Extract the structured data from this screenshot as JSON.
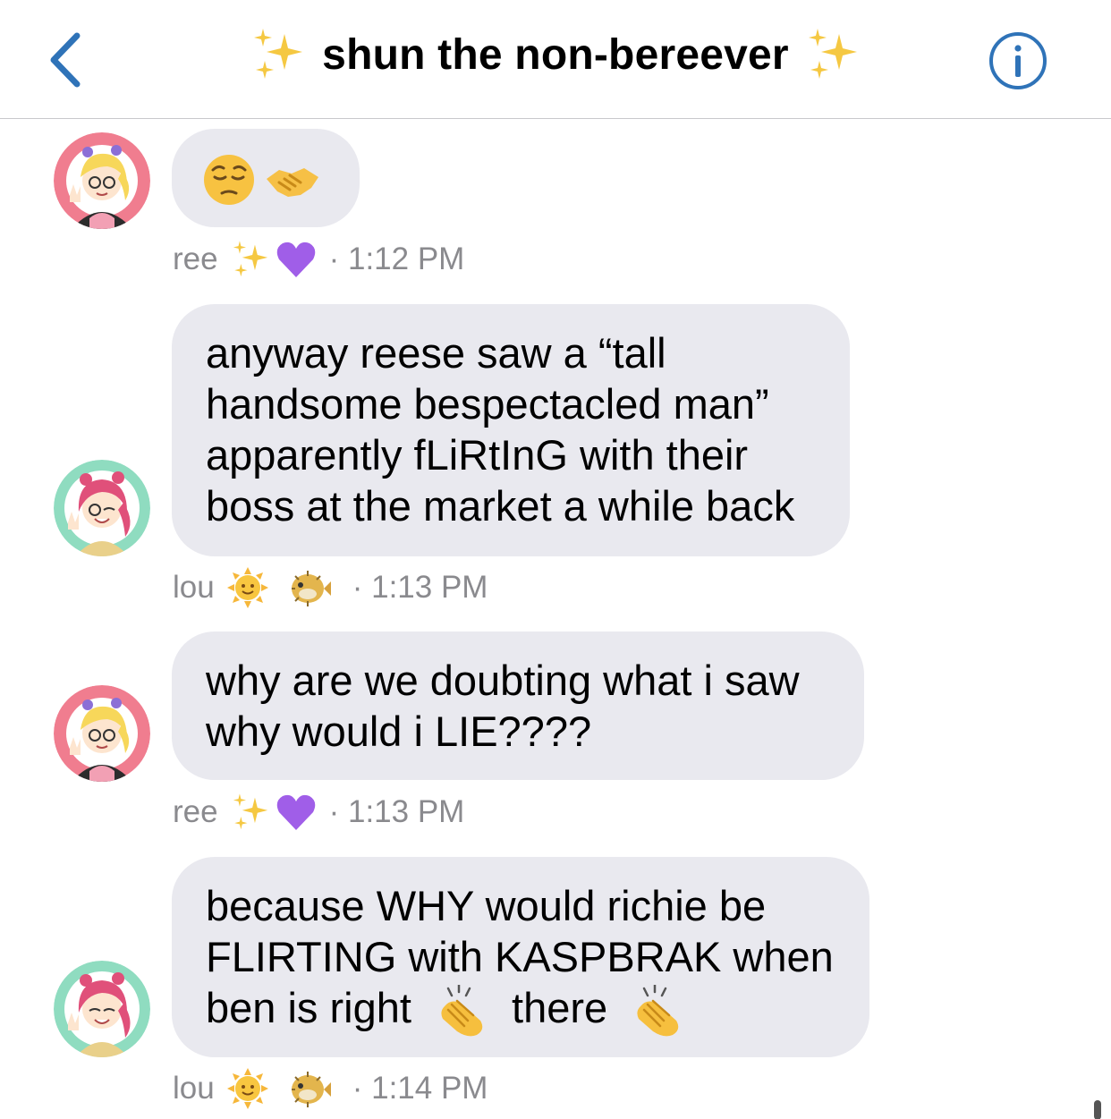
{
  "header": {
    "title": "shun the non-bereever",
    "back_icon": "chevron-left-icon",
    "info_icon": "info-icon",
    "accent_color": "#2f73b8"
  },
  "messages": [
    {
      "sender": "ree",
      "avatar": "avatar-ree",
      "content_emoji": [
        "pensive-face-emoji",
        "handshake-emoji"
      ],
      "timestamp": "· 1:12 PM"
    },
    {
      "sender": "lou",
      "avatar": "avatar-lou",
      "lines": [
        "anyway reese saw a “tall",
        "handsome bespectacled man”",
        "apparently fLiRtInG with their",
        "boss at the market a while back"
      ],
      "timestamp": "· 1:13 PM"
    },
    {
      "sender": "ree",
      "avatar": "avatar-ree",
      "lines": [
        "why are we doubting what i saw",
        "why would i LIE????"
      ],
      "timestamp": "· 1:13 PM"
    },
    {
      "sender": "lou",
      "avatar": "avatar-lou",
      "lines": [
        "because WHY would richie be",
        "FLIRTING with KASPBRAK when"
      ],
      "line3_parts": [
        "ben is right",
        "there"
      ],
      "timestamp": "· 1:14 PM"
    }
  ],
  "colors": {
    "bubble": "#e9e9ef",
    "meta_text": "#8a8a8e",
    "ree_ring": "#f07d8f",
    "lou_ring": "#8fdcc0"
  }
}
